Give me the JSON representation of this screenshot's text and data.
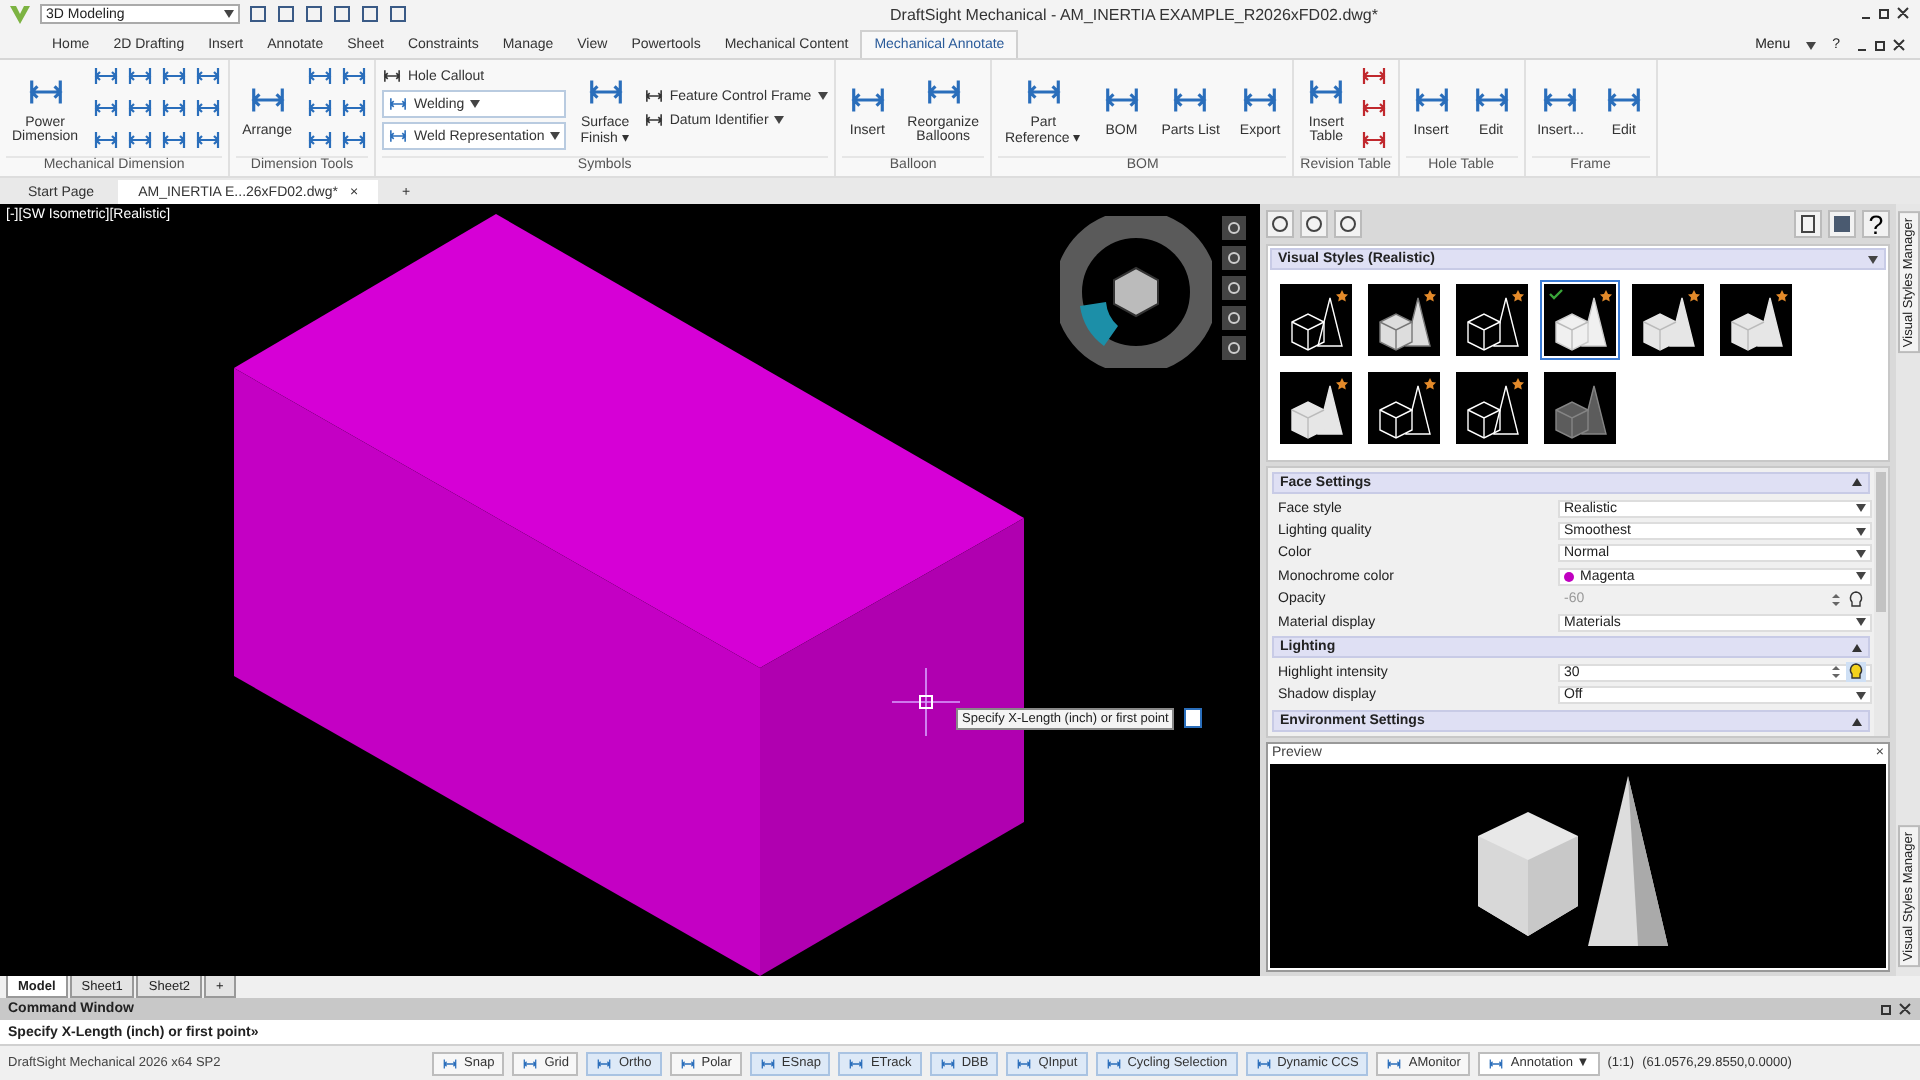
{
  "title_bar": {
    "workspace": "3D Modeling",
    "title": "DraftSight Mechanical - AM_INERTIA EXAMPLE_R2026xFD02.dwg*"
  },
  "menu_tabs": [
    {
      "label": "Home",
      "selected": false
    },
    {
      "label": "2D Drafting",
      "selected": false
    },
    {
      "label": "Insert",
      "selected": false
    },
    {
      "label": "Annotate",
      "selected": false
    },
    {
      "label": "Sheet",
      "selected": false
    },
    {
      "label": "Constraints",
      "selected": false
    },
    {
      "label": "Manage",
      "selected": false
    },
    {
      "label": "View",
      "selected": false
    },
    {
      "label": "Powertools",
      "selected": false
    },
    {
      "label": "Mechanical Content",
      "selected": false
    },
    {
      "label": "Mechanical Annotate",
      "selected": true
    }
  ],
  "menu_right": {
    "menu": "Menu",
    "help": "?"
  },
  "ribbon": [
    {
      "name": "Mechanical Dimension",
      "tools": [
        {
          "kind": "large",
          "label": "Power\nDimension",
          "caret": false
        },
        {
          "kind": "grid_wide"
        }
      ]
    },
    {
      "name": "Dimension Tools",
      "tools": [
        {
          "kind": "large",
          "label": "Arrange",
          "caret": false
        },
        {
          "kind": "grid_narrow"
        }
      ]
    },
    {
      "name": "Symbols",
      "tools": [
        {
          "kind": "stack",
          "items": [
            {
              "kind": "small",
              "label": "Hole Callout",
              "caret": false
            },
            {
              "kind": "combo",
              "label": "Welding",
              "caret": true
            },
            {
              "kind": "combo",
              "label": "Weld Representation",
              "caret": true
            }
          ]
        },
        {
          "kind": "large",
          "label": "Surface\nFinish ▾",
          "caret": false
        },
        {
          "kind": "stack",
          "items": [
            {
              "kind": "small",
              "label": "Feature Control Frame",
              "caret": true
            },
            {
              "kind": "small",
              "label": "Datum Identifier",
              "caret": true
            }
          ]
        }
      ]
    },
    {
      "name": "Balloon",
      "tools": [
        {
          "kind": "large",
          "label": "Insert",
          "caret": false
        },
        {
          "kind": "large",
          "label": "Reorganize\nBalloons",
          "caret": false
        }
      ]
    },
    {
      "name": "BOM",
      "tools": [
        {
          "kind": "large",
          "label": "Part\nReference ▾",
          "caret": false
        },
        {
          "kind": "large",
          "label": "BOM",
          "caret": false
        },
        {
          "kind": "large",
          "label": "Parts List",
          "caret": false
        },
        {
          "kind": "large",
          "label": "Export",
          "caret": false
        }
      ]
    },
    {
      "name": "Revision Table",
      "tools": [
        {
          "kind": "large",
          "label": "Insert\nTable",
          "caret": false
        },
        {
          "kind": "icon_col"
        }
      ]
    },
    {
      "name": "Hole Table",
      "tools": [
        {
          "kind": "large",
          "label": "Insert",
          "caret": false
        },
        {
          "kind": "large",
          "label": "Edit",
          "caret": false
        }
      ]
    },
    {
      "name": "Frame",
      "tools": [
        {
          "kind": "large",
          "label": "Insert...",
          "caret": false
        },
        {
          "kind": "large",
          "label": "Edit",
          "caret": false
        }
      ]
    }
  ],
  "doc_tabs": [
    {
      "label": "Start Page",
      "selected": false
    },
    {
      "label": "AM_INERTIA E...26xFD02.dwg*",
      "selected": true,
      "close": "×"
    }
  ],
  "doc_new_tab": "+",
  "viewport": {
    "label": "[-][SW Isometric][Realistic]",
    "tooltip": "Specify X-Length (inch) or first point"
  },
  "sheet_tabs": [
    {
      "label": "Model",
      "selected": true
    },
    {
      "label": "Sheet1",
      "selected": false
    },
    {
      "label": "Sheet2",
      "selected": false
    }
  ],
  "sheet_new_tab": "+",
  "command_window": {
    "title": "Command Window",
    "prompt": "Specify X-Length (inch) or first point»"
  },
  "status_bar": {
    "version": "DraftSight Mechanical 2026  x64 SP2",
    "toggles": [
      {
        "label": "Snap",
        "on": false,
        "kind": "toggle"
      },
      {
        "label": "Grid",
        "on": false,
        "kind": "toggle"
      },
      {
        "label": "Ortho",
        "on": true,
        "kind": "toggle"
      },
      {
        "label": "Polar",
        "on": false,
        "kind": "toggle"
      },
      {
        "label": "ESnap",
        "on": true,
        "kind": "toggle"
      },
      {
        "label": "ETrack",
        "on": true,
        "kind": "toggle"
      },
      {
        "label": "DBB",
        "on": true,
        "kind": "toggle"
      },
      {
        "label": "QInput",
        "on": true,
        "kind": "toggle"
      },
      {
        "label": "Cycling Selection",
        "on": true,
        "kind": "toggle"
      },
      {
        "label": "Dynamic CCS",
        "on": true,
        "kind": "toggle"
      },
      {
        "label": "AMonitor",
        "on": false,
        "kind": "toggle"
      },
      {
        "label": "Annotation ▼",
        "kind": "dropdown"
      }
    ],
    "scale": "(1:1)",
    "coordinates": "(61.0576,29.8550,0.0000)"
  },
  "panel": {
    "side_tab": "Visual Styles Manager",
    "styles_title": "Visual Styles (Realistic)",
    "styles": [
      {
        "kind": "wireframe",
        "selected": false,
        "badge": true
      },
      {
        "kind": "shaded_edges",
        "selected": false,
        "badge": true
      },
      {
        "kind": "hidden",
        "selected": false,
        "badge": true
      },
      {
        "kind": "realistic",
        "selected": true,
        "badge": true
      },
      {
        "kind": "shaded",
        "selected": false,
        "badge": true
      },
      {
        "kind": "shaded",
        "selected": false,
        "badge": true
      },
      {
        "kind": "shaded",
        "selected": false,
        "badge": true
      },
      {
        "kind": "hidden",
        "selected": false,
        "badge": true
      },
      {
        "kind": "wireframe",
        "selected": false,
        "badge": true
      },
      {
        "kind": "xray",
        "selected": false
      }
    ],
    "sections": [
      {
        "title": "Face Settings",
        "expanded": true,
        "rows": [
          {
            "label": "Face style",
            "value": "Realistic",
            "kind": "dropdown",
            "disabled": false
          },
          {
            "label": "Lighting quality",
            "value": "Smoothest",
            "kind": "dropdown",
            "disabled": false
          },
          {
            "label": "Color",
            "value": "Normal",
            "kind": "dropdown",
            "disabled": false
          },
          {
            "label": "Monochrome color",
            "value": "Magenta",
            "kind": "color",
            "color": "#c000c0",
            "disabled": false
          },
          {
            "label": "Opacity",
            "value": "-60",
            "kind": "spin",
            "bulb_on": false,
            "disabled": true
          },
          {
            "label": "Material display",
            "value": "Materials",
            "kind": "dropdown",
            "disabled": false
          }
        ]
      },
      {
        "title": "Lighting",
        "expanded": true,
        "rows": [
          {
            "label": "Highlight intensity",
            "value": "30",
            "kind": "spin",
            "bulb_on": true,
            "disabled": false
          },
          {
            "label": "Shadow display",
            "value": "Off",
            "kind": "dropdown",
            "disabled": false
          }
        ]
      },
      {
        "title": "Environment Settings",
        "expanded": true
      }
    ],
    "preview": {
      "title": "Preview",
      "close": "×"
    },
    "bottom_tab": "Visual Styles Manager"
  }
}
